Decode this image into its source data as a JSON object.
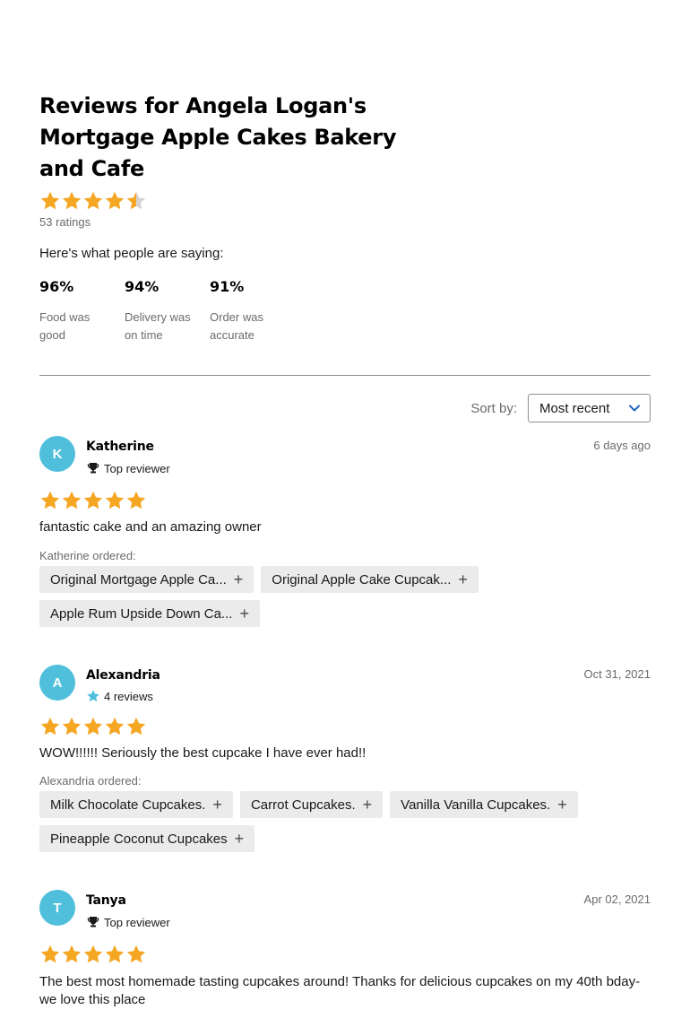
{
  "header": {
    "title": "Reviews for Angela Logan's Mortgage Apple Cakes Bakery and Cafe",
    "rating": 4.5,
    "ratings_count": "53 ratings",
    "saying": "Here's what people are saying:"
  },
  "stats": [
    {
      "pct": "96%",
      "label": "Food was good"
    },
    {
      "pct": "94%",
      "label": "Delivery was on time"
    },
    {
      "pct": "91%",
      "label": "Order was accurate"
    }
  ],
  "sort": {
    "label": "Sort by:",
    "value": "Most recent"
  },
  "colors": {
    "star": "#f5a623",
    "avatar": "#4fbfdc",
    "chip_bg": "#ebebeb"
  },
  "reviews": [
    {
      "initial": "K",
      "name": "Katherine",
      "badge_icon": "trophy-icon",
      "badge": "Top reviewer",
      "date": "6 days ago",
      "stars": 5,
      "text": "fantastic cake and an amazing owner",
      "ordered_label": "Katherine ordered:",
      "items": [
        "Original Mortgage Apple Ca...",
        "Original Apple Cake Cupcak...",
        "Apple Rum Upside Down Ca..."
      ]
    },
    {
      "initial": "A",
      "name": "Alexandria",
      "badge_icon": "star-icon",
      "badge": "4 reviews",
      "date": "Oct 31, 2021",
      "stars": 5,
      "text": "WOW!!!!!! Seriously the best cupcake I have ever had!!",
      "ordered_label": "Alexandria ordered:",
      "items": [
        "Milk Chocolate Cupcakes.",
        "Carrot Cupcakes.",
        "Vanilla Vanilla Cupcakes.",
        "Pineapple Coconut Cupcakes"
      ]
    },
    {
      "initial": "T",
      "name": "Tanya",
      "badge_icon": "trophy-icon",
      "badge": "Top reviewer",
      "date": "Apr 02, 2021",
      "stars": 5,
      "text": "The best most homemade tasting cupcakes around! Thanks for delicious cupcakes on my 40th bday-we love this place"
    }
  ]
}
